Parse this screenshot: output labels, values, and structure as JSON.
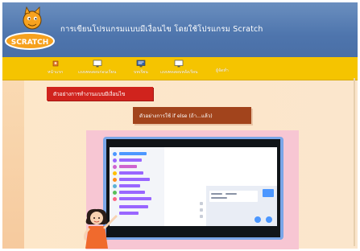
{
  "header": {
    "title": "การเขียนโปรแกรมแบบมีเงื่อนไข โดยใช้โปรแกรม Scratch",
    "logo_text": "SCRATCH"
  },
  "nav": {
    "items": [
      {
        "label": "หน้าแรก",
        "icon": "home-icon"
      },
      {
        "label": "แบบทดสอบก่อนเรียน",
        "icon": "monitor-icon"
      },
      {
        "label": "บทเรียน",
        "icon": "lesson-screen-icon"
      },
      {
        "label": "แบบทดสอบหลังเรียน",
        "icon": "monitor-icon"
      },
      {
        "label": "ผู้จัดทำ",
        "icon": ""
      }
    ]
  },
  "content": {
    "section_heading": "ตัวอย่างการทำงานแบบมีเงื่อนไข",
    "sub_heading": "ตัวอย่างการใช้ if  else (ถ้า...แล้ว)"
  },
  "colors": {
    "header_bg": "#4e75ad",
    "nav_bg": "#f5c400",
    "red_heading": "#d0231d",
    "brown_heading": "#a2441c",
    "monitor_frame": "#7aa6e8",
    "video_bg": "#f7c6d3"
  }
}
